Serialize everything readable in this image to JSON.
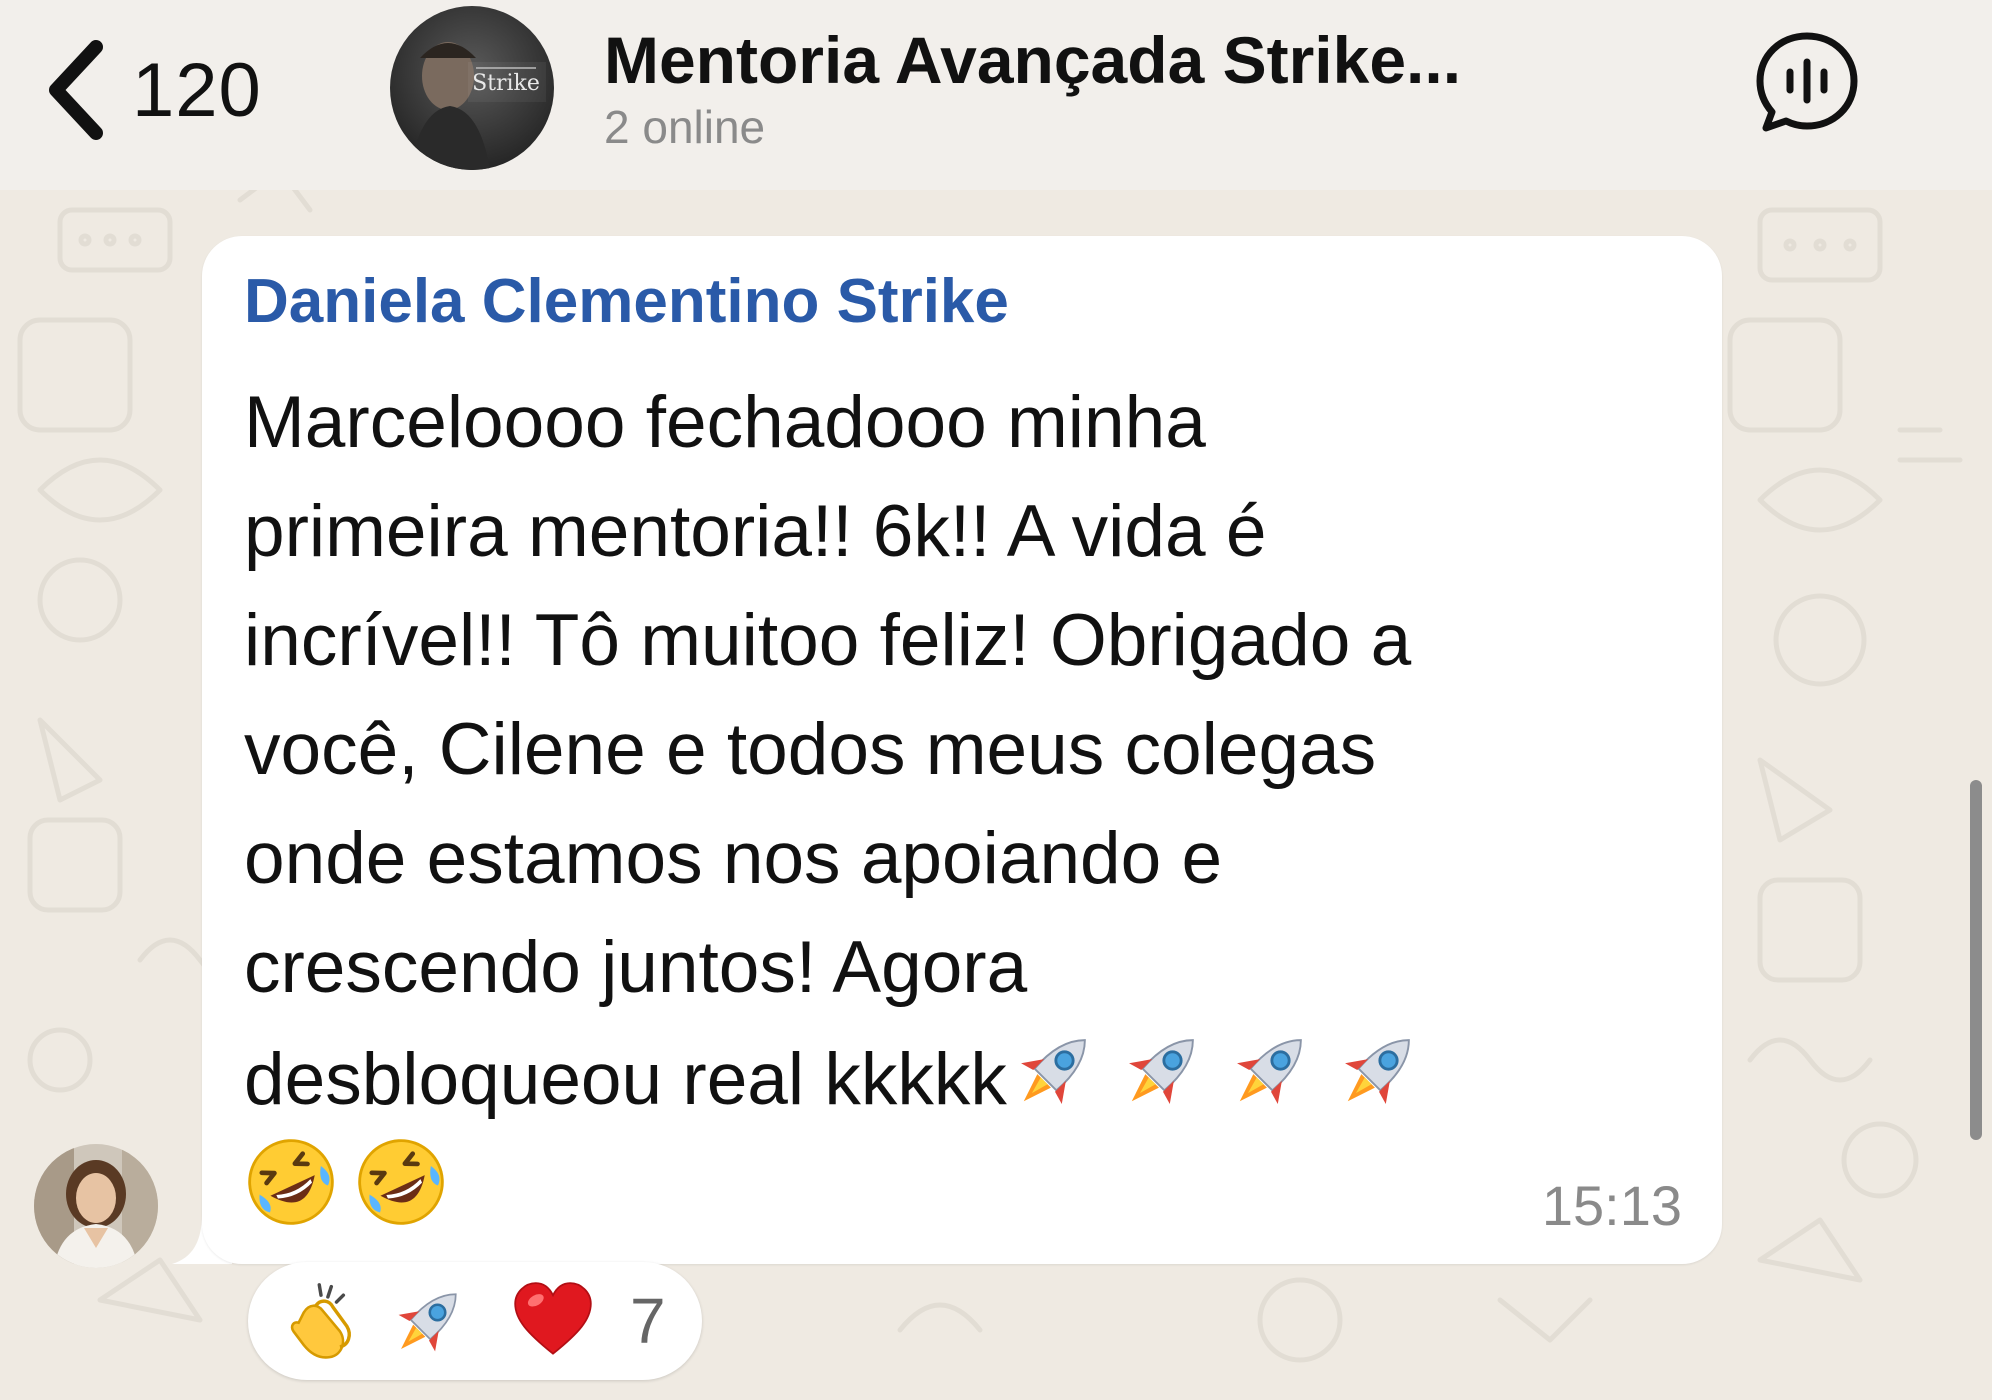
{
  "header": {
    "back_count": "120",
    "title": "Mentoria Avançada Strike...",
    "subtitle": "2 online",
    "avatar_text": "Strike"
  },
  "message": {
    "sender": "Daniela Clementino Strike",
    "text": "Marceloooo fechadooo minha\nprimeira mentoria!! 6k!! A vida é\nincrível!! Tô muitoo feliz! Obrigado a\nvocê, Cilene e todos meus colegas\nonde estamos nos apoiando e\ncrescendo juntos! Agora\ndesbloqueou real kkkkk",
    "trailing_emojis": [
      "rocket",
      "rocket",
      "rocket",
      "rocket"
    ],
    "second_line_emojis": [
      "rolling-laughing",
      "rolling-laughing"
    ],
    "time": "15:13"
  },
  "reactions": {
    "items": [
      "clapping-hands",
      "rocket",
      "red-heart"
    ],
    "count": "7"
  },
  "colors": {
    "sender": "#2a5aa8",
    "background": "#efeae2",
    "bubble": "#ffffff",
    "secondary_text": "#8a8a8a"
  }
}
